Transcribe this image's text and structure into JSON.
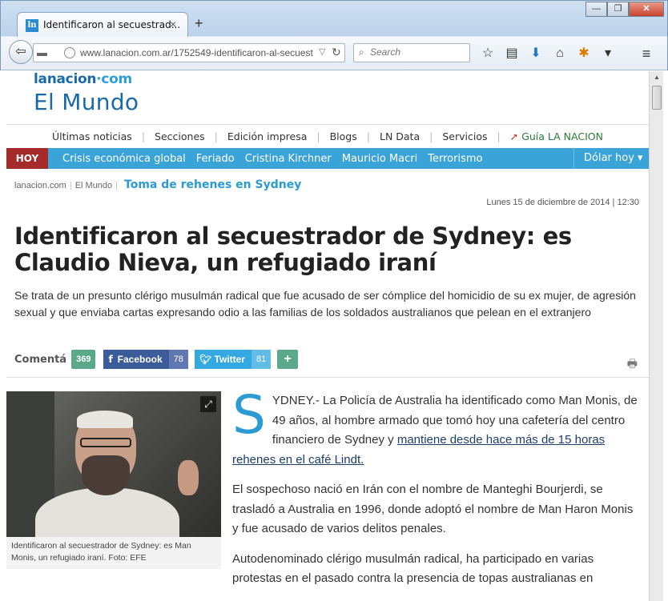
{
  "browser": {
    "tab_title": "Identificaron al secuestrad...",
    "tab_close": "×",
    "new_tab": "+",
    "favicon_text": "ln",
    "url": "www.lanacion.com.ar/1752549-identificaron-al-secuest",
    "search_placeholder": "Search",
    "window_buttons": [
      "—",
      "❐",
      "✕"
    ]
  },
  "site": {
    "logo_main": "lanacion",
    "logo_suffix": "·com",
    "section": "El Mundo"
  },
  "top_menu": [
    "Últimas noticias",
    "Secciones",
    "Edición impresa",
    "Blogs",
    "LN Data",
    "Servicios"
  ],
  "guia_label": "Guía LA NACION",
  "hot_bar": {
    "hoy": "HOY",
    "items": [
      "Crisis económica global",
      "Feriado",
      "Cristina Kirchner",
      "Mauricio Macri",
      "Terrorismo"
    ],
    "dolar": "Dólar hoy ▾"
  },
  "breadcrumb": {
    "home": "lanacion.com",
    "section": "El Mundo",
    "topic": "Toma de rehenes en Sydney"
  },
  "date": "Lunes 15 de diciembre de 2014 | 12:30",
  "headline": "Identificaron al secuestrador de Sydney: es Claudio Nieva, un refugiado iraní",
  "summary": "Se trata de un presunto clérigo musulmán radical que fue acusado de ser cómplice del homicidio de su ex mujer, de agresión sexual y que enviaba cartas expresando odio a las familias de los soldados australianos que pelean en el extranjero",
  "share": {
    "comenta_label": "Comentá",
    "comments_count": "369",
    "facebook_label": "Facebook",
    "facebook_count": "78",
    "twitter_label": "Twitter",
    "twitter_count": "81",
    "plus": "+"
  },
  "photo_caption": "Identificaron al secuestrador de Sydney: es Man Monis, un refugiado iraní. Foto: EFE",
  "article": {
    "dropcap": "S",
    "p1_text": "YDNEY.- La Policía de Australia ha identificado como Man Monis, de 49 años, al hombre armado que tomó hoy una cafetería del centro financiero de Sydney y ",
    "p1_link": "mantiene desde hace más de 15 horas rehenes en el café Lindt.",
    "p2": "El sospechoso nació en Irán con el nombre de Manteghi Bourjerdi, se trasladó a Australia en 1996, donde adoptó el nombre de Man Haron Monis y fue acusado de varios delitos penales.",
    "p3": "Autodenominado clérigo musulmán radical, ha participado en varias protestas en el pasado contra la presencia de topas australianas en"
  }
}
